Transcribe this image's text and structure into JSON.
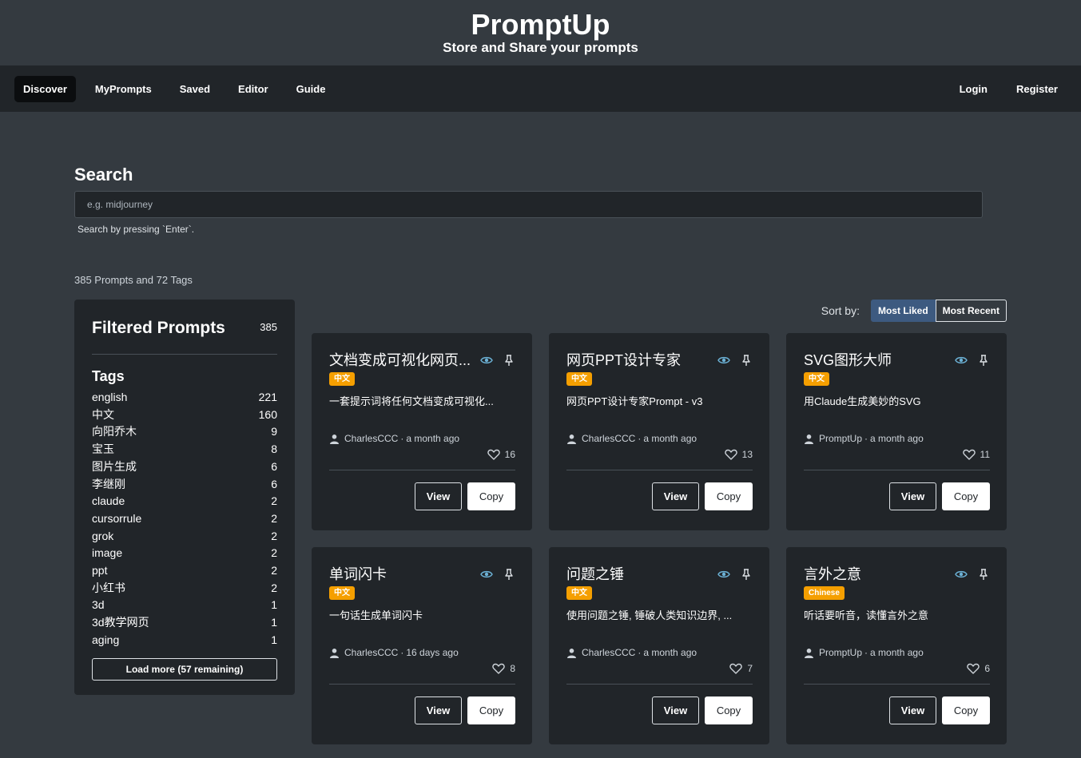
{
  "header": {
    "title": "PromptUp",
    "subtitle": "Store and Share your prompts"
  },
  "nav": {
    "left": [
      "Discover",
      "MyPrompts",
      "Saved",
      "Editor",
      "Guide"
    ],
    "right": [
      "Login",
      "Register"
    ],
    "active": "Discover"
  },
  "search": {
    "title": "Search",
    "placeholder": "e.g. midjourney",
    "help": "Search by pressing `Enter`."
  },
  "stats": "385 Prompts and 72 Tags",
  "sidebar": {
    "title": "Filtered Prompts",
    "count": "385",
    "tags_title": "Tags",
    "tags": [
      {
        "name": "english",
        "count": "221"
      },
      {
        "name": "中文",
        "count": "160"
      },
      {
        "name": "向阳乔木",
        "count": "9"
      },
      {
        "name": "宝玉",
        "count": "8"
      },
      {
        "name": "图片生成",
        "count": "6"
      },
      {
        "name": "李继刚",
        "count": "6"
      },
      {
        "name": "claude",
        "count": "2"
      },
      {
        "name": "cursorrule",
        "count": "2"
      },
      {
        "name": "grok",
        "count": "2"
      },
      {
        "name": "image",
        "count": "2"
      },
      {
        "name": "ppt",
        "count": "2"
      },
      {
        "name": "小红书",
        "count": "2"
      },
      {
        "name": "3d",
        "count": "1"
      },
      {
        "name": "3d教学网页",
        "count": "1"
      },
      {
        "name": "aging",
        "count": "1"
      }
    ],
    "load_more": "Load more (57 remaining)"
  },
  "sort": {
    "label": "Sort by:",
    "options": [
      "Most Liked",
      "Most Recent"
    ],
    "active": "Most Liked"
  },
  "cards": [
    {
      "title": "文档变成可视化网页...",
      "badge": "中文",
      "desc": "一套提示词将任何文档变成可视化...",
      "author": "CharlesCCC",
      "time": "a month ago",
      "likes": "16",
      "view": "View",
      "copy": "Copy"
    },
    {
      "title": "网页PPT设计专家",
      "badge": "中文",
      "desc": "网页PPT设计专家Prompt - v3",
      "author": "CharlesCCC",
      "time": "a month ago",
      "likes": "13",
      "view": "View",
      "copy": "Copy"
    },
    {
      "title": "SVG图形大师",
      "badge": "中文",
      "desc": "用Claude生成美妙的SVG",
      "author": "PromptUp",
      "time": "a month ago",
      "likes": "11",
      "view": "View",
      "copy": "Copy"
    },
    {
      "title": "单词闪卡",
      "badge": "中文",
      "desc": "一句话生成单词闪卡",
      "author": "CharlesCCC",
      "time": "16 days ago",
      "likes": "8",
      "view": "View",
      "copy": "Copy"
    },
    {
      "title": "问题之锤",
      "badge": "中文",
      "desc": "使用问题之锤, 锤破人类知识边界, ...",
      "author": "CharlesCCC",
      "time": "a month ago",
      "likes": "7",
      "view": "View",
      "copy": "Copy"
    },
    {
      "title": "言外之意",
      "badge": "Chinese",
      "desc": "听话要听音，读懂言外之意",
      "author": "PromptUp",
      "time": "a month ago",
      "likes": "6",
      "view": "View",
      "copy": "Copy"
    }
  ],
  "colors": {
    "page_bg": "#343a40",
    "nav_bg": "#212529",
    "card_bg": "#212529",
    "badge": "#f59f00",
    "sort_active": "#3d5a80",
    "icon_blue": "#6cb2d6"
  },
  "icons": {
    "eye": "eye-icon",
    "pin": "pin-icon",
    "user": "user-icon",
    "heart": "heart-icon"
  }
}
